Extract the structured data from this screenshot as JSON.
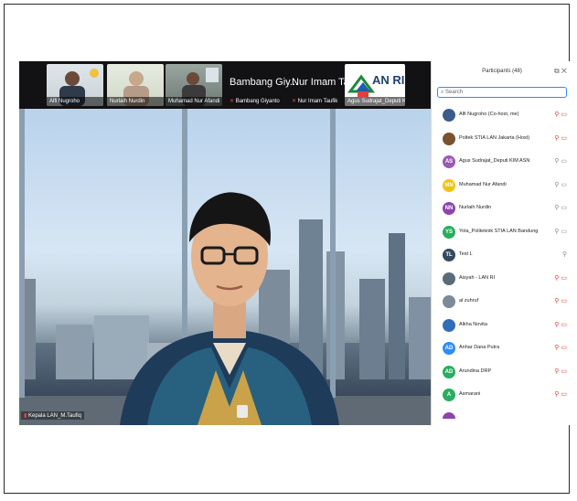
{
  "strip": {
    "thumbs": [
      {
        "name": "Alfi Nugroho"
      },
      {
        "name": "Nurlaih Nurdin"
      },
      {
        "name": "Muhamad Nur Afandi"
      }
    ],
    "text_tiles": [
      {
        "big": "Bambang Giy...",
        "small": "Bambang Giyanto"
      },
      {
        "big": "Nur Imam Ta...",
        "small": "Nur Imam Taufik"
      }
    ],
    "logo_tile": {
      "logo_text": "AN RI",
      "name": "Agus Sudrajat_Deputi KI..."
    }
  },
  "main_video": {
    "name_label": "Kepala LAN_M.Taufiq"
  },
  "panel": {
    "title": "Participants (48)",
    "search_placeholder": "Search",
    "participants": [
      {
        "initials": "",
        "name": "Alfi Nugroho (Co-host, me)",
        "color": "#3b5b8a",
        "mic": "muted"
      },
      {
        "initials": "",
        "name": "Poltek STIA LAN Jakarta (Host)",
        "color": "#7a5230",
        "mic": "muted"
      },
      {
        "initials": "AS",
        "name": "Agus Sudrajat_Deputi KIM ASN",
        "color": "#9b59b6",
        "mic": "unmuted"
      },
      {
        "initials": "MN",
        "name": "Muhamad Nur Afandi",
        "color": "#f1c40f",
        "mic": "unmuted"
      },
      {
        "initials": "NN",
        "name": "Nurlaih Nurdin",
        "color": "#8e44ad",
        "mic": "unmuted"
      },
      {
        "initials": "YS",
        "name": "Yola_Politeknik STIA LAN Bandung",
        "color": "#27ae60",
        "mic": "unmuted"
      },
      {
        "initials": "TL",
        "name": "Test L",
        "color": "#34495e",
        "mic": "unmuted"
      },
      {
        "initials": "",
        "name": "Aisyah - LAN RI",
        "color": "#5a6b7b",
        "mic": "muted"
      },
      {
        "initials": "",
        "name": "al zuhruf",
        "color": "#7b8a99",
        "mic": "muted"
      },
      {
        "initials": "",
        "name": "Alkha Novita",
        "color": "#2e6fb7",
        "mic": "muted"
      },
      {
        "initials": "AD",
        "name": "Anhar Dana Putra",
        "color": "#2d8cff",
        "mic": "muted"
      },
      {
        "initials": "AD",
        "name": "Arundina DRP",
        "color": "#27ae60",
        "mic": "muted"
      },
      {
        "initials": "A",
        "name": "Asmarani",
        "color": "#27ae60",
        "mic": "muted"
      },
      {
        "initials": "",
        "name": "",
        "color": "#8e44ad",
        "mic": "muted"
      }
    ]
  }
}
